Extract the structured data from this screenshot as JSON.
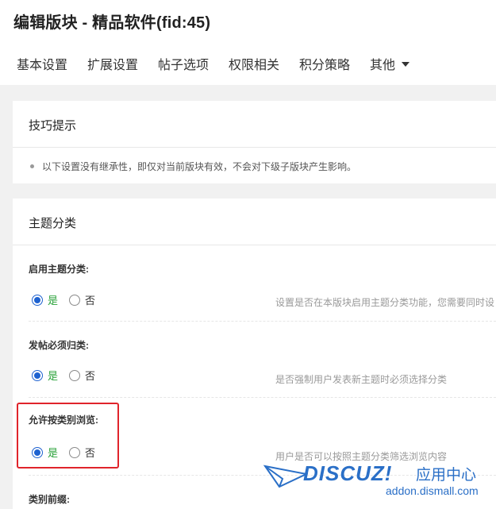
{
  "page": {
    "title": "编辑版块 - 精品软件(fid:45)"
  },
  "tabs": [
    {
      "label": "基本设置"
    },
    {
      "label": "扩展设置"
    },
    {
      "label": "帖子选项"
    },
    {
      "label": "权限相关"
    },
    {
      "label": "积分策略"
    },
    {
      "label": "其他"
    }
  ],
  "tips": {
    "title": "技巧提示",
    "items": [
      "以下设置没有继承性，即仅对当前版块有效，不会对下级子版块产生影响。"
    ]
  },
  "theme_section": {
    "title": "主题分类",
    "settings": [
      {
        "label": "启用主题分类:",
        "yes": "是",
        "no": "否",
        "selected": "是",
        "desc": "设置是否在本版块启用主题分类功能，您需要同时设"
      },
      {
        "label": "发帖必须归类:",
        "yes": "是",
        "no": "否",
        "selected": "是",
        "desc": "是否强制用户发表新主题时必须选择分类"
      },
      {
        "label": "允许按类别浏览:",
        "yes": "是",
        "no": "否",
        "selected": "是",
        "desc": "用户是否可以按照主题分类筛选浏览内容"
      },
      {
        "label": "类别前缀:"
      }
    ]
  },
  "watermark": {
    "logo": "DISCUZ!",
    "cn": "应用中心",
    "url": "addon.dismall.com"
  },
  "colors": {
    "accent": "#1e62d0",
    "yes_text": "#2aa23a",
    "highlight": "#e0242b",
    "watermark": "#2a6fc7"
  }
}
